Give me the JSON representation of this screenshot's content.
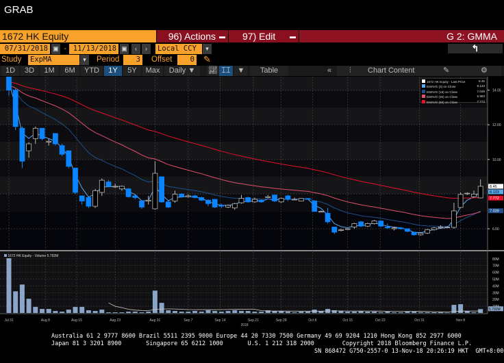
{
  "window": {
    "title": "GRAB"
  },
  "header": {
    "security": "1672 HK Equity",
    "actions": "96) Actions",
    "edit": "97) Edit",
    "page_code": "G 2: GMMA"
  },
  "dates": {
    "start": "07/31/2018",
    "sep": "-",
    "end": "11/13/2018",
    "currency": "Local CCY"
  },
  "study": {
    "label": "Study",
    "value": "ExpMA",
    "period_label": "Period",
    "period": "3",
    "offset_label": "Offset",
    "offset": "0"
  },
  "tabs": {
    "ranges": [
      "1D",
      "3D",
      "1M",
      "6M",
      "YTD",
      "1Y",
      "5Y",
      "Max"
    ],
    "active": "1Y",
    "frequency": "Daily",
    "table": "Table",
    "chart_content": "Chart Content"
  },
  "legend": {
    "items": [
      {
        "label": "1672 HK Equity - Last Price",
        "value": "8.45",
        "color": "#ffffff"
      },
      {
        "label": "EMAVG (3) on Close",
        "value": "8.133",
        "color": "#5aaaf0"
      },
      {
        "label": "EMAVG (15) on Close",
        "value": "7.039",
        "color": "#1e4f8a"
      },
      {
        "label": "EMAVG (30) on Close",
        "value": "6.983",
        "color": "#e0506a"
      },
      {
        "label": "EMAVG (60) on Close",
        "value": "7.772",
        "color": "#e8102a"
      }
    ]
  },
  "volume_legend": "1672 HK Equity - Volume 5.792M",
  "chart_data": {
    "type": "candlestick",
    "price_ticks": [
      "14.00",
      "12.00",
      "10.00",
      "6.00"
    ],
    "price_tick_values": [
      14,
      12,
      10,
      6
    ],
    "price_tags": [
      {
        "text": "8.45",
        "value": 8.45,
        "bg": "#ffffff",
        "fg": "#000"
      },
      {
        "text": "8.133",
        "value": 8.133,
        "bg": "#5aaaf0",
        "fg": "#000"
      },
      {
        "text": "7.772",
        "value": 7.772,
        "bg": "#e8102a",
        "fg": "#fff"
      },
      {
        "text": "7.039",
        "value": 7.039,
        "bg": "#1e4f8a",
        "fg": "#fff"
      }
    ],
    "volume_ticks": [
      "80M",
      "70M",
      "60M",
      "50M",
      "40M",
      "30M",
      "20M",
      "10M"
    ],
    "volume_tag": "5.792M",
    "x_labels": [
      {
        "text": "Jul 31",
        "i": 0
      },
      {
        "text": "Aug 8",
        "i": 5.5
      },
      {
        "text": "Aug 15",
        "i": 10.2
      },
      {
        "text": "Aug 23",
        "i": 16
      },
      {
        "text": "Aug 31",
        "i": 22
      },
      {
        "text": "Sep 7",
        "i": 27
      },
      {
        "text": "Sep 14",
        "i": 31.8
      },
      {
        "text": "Sep 21",
        "i": 36.8
      },
      {
        "text": "Sep 28",
        "i": 41
      },
      {
        "text": "Oct 8",
        "i": 45.7
      },
      {
        "text": "Oct 15",
        "i": 51
      },
      {
        "text": "Oct 23",
        "i": 55.9
      },
      {
        "text": "Oct 31",
        "i": 61.8
      },
      {
        "text": "Nov 8",
        "i": 68
      }
    ],
    "year_label": "2018",
    "ohlc": [
      [
        14.8,
        14.9,
        13.7,
        14.0
      ],
      [
        14.0,
        14.1,
        11.7,
        11.9
      ],
      [
        11.8,
        11.9,
        9.5,
        9.9
      ],
      [
        10.5,
        11.0,
        10.1,
        10.9
      ],
      [
        11.2,
        11.9,
        10.9,
        11.8
      ],
      [
        11.8,
        11.8,
        11.1,
        11.2
      ],
      [
        11.0,
        11.2,
        10.8,
        11.05
      ],
      [
        11.5,
        11.5,
        10.8,
        10.9
      ],
      [
        10.8,
        10.9,
        10.2,
        10.3
      ],
      [
        10.5,
        10.5,
        9.5,
        9.6
      ],
      [
        9.5,
        9.5,
        8.0,
        8.1
      ],
      [
        7.9,
        7.9,
        7.4,
        7.6
      ],
      [
        7.8,
        7.8,
        7.2,
        7.3
      ],
      [
        7.3,
        8.3,
        7.2,
        8.2
      ],
      [
        8.1,
        8.9,
        7.9,
        8.8
      ],
      [
        8.7,
        8.8,
        8.4,
        8.45
      ],
      [
        8.45,
        8.6,
        8.35,
        8.45
      ],
      [
        8.3,
        8.5,
        8.2,
        8.45
      ],
      [
        8.3,
        8.35,
        7.8,
        7.85
      ],
      [
        7.9,
        7.95,
        7.7,
        7.8
      ],
      [
        7.6,
        7.6,
        7.15,
        7.25
      ],
      [
        7.6,
        7.9,
        7.4,
        7.65
      ],
      [
        7.15,
        9.9,
        7.1,
        9.2
      ],
      [
        9.0,
        9.0,
        7.5,
        7.55
      ],
      [
        7.55,
        7.6,
        7.2,
        7.25
      ],
      [
        7.6,
        8.2,
        7.5,
        8.0
      ],
      [
        8.0,
        8.05,
        7.8,
        7.85
      ],
      [
        7.85,
        8.0,
        7.8,
        7.9
      ],
      [
        7.9,
        7.95,
        7.75,
        7.8
      ],
      [
        7.8,
        7.85,
        7.6,
        7.65
      ],
      [
        7.65,
        7.7,
        7.3,
        7.45
      ],
      [
        7.7,
        7.7,
        7.2,
        7.25
      ],
      [
        7.35,
        7.45,
        7.2,
        7.3
      ],
      [
        7.25,
        7.4,
        7.2,
        7.35
      ],
      [
        7.2,
        7.5,
        7.1,
        7.45
      ],
      [
        7.5,
        7.95,
        7.45,
        7.75
      ],
      [
        7.8,
        7.85,
        7.5,
        7.55
      ],
      [
        7.55,
        7.8,
        7.5,
        7.7
      ],
      [
        7.65,
        7.7,
        7.5,
        7.55
      ],
      [
        7.8,
        7.95,
        7.75,
        7.85
      ],
      [
        7.95,
        7.95,
        7.55,
        7.6
      ],
      [
        7.55,
        7.8,
        7.5,
        7.75
      ],
      [
        7.9,
        7.95,
        7.6,
        7.7
      ],
      [
        7.7,
        7.8,
        7.65,
        7.7
      ],
      [
        7.6,
        7.75,
        7.6,
        7.75
      ],
      [
        7.75,
        7.75,
        7.7,
        7.7
      ],
      [
        7.6,
        7.6,
        7.0,
        7.0
      ],
      [
        7.0,
        7.05,
        6.95,
        7.0
      ],
      [
        6.9,
        7.2,
        6.3,
        6.4
      ],
      [
        6.1,
        6.1,
        5.7,
        5.8
      ],
      [
        5.9,
        6.0,
        5.85,
        5.95
      ],
      [
        6.0,
        6.0,
        5.95,
        6.0
      ],
      [
        6.1,
        6.35,
        6.0,
        6.3
      ],
      [
        6.4,
        6.45,
        6.1,
        6.15
      ],
      [
        6.15,
        6.35,
        6.1,
        6.3
      ],
      [
        6.3,
        6.5,
        6.25,
        6.45
      ],
      [
        6.45,
        6.45,
        6.1,
        6.15
      ],
      [
        6.1,
        6.3,
        6.0,
        6.05
      ],
      [
        6.0,
        6.1,
        5.9,
        6.05
      ],
      [
        6.05,
        6.1,
        5.95,
        6.0
      ],
      [
        6.0,
        6.0,
        5.8,
        5.85
      ],
      [
        5.8,
        5.8,
        5.6,
        5.65
      ],
      [
        5.65,
        5.8,
        5.6,
        5.75
      ],
      [
        5.75,
        6.0,
        5.7,
        5.95
      ],
      [
        5.95,
        6.1,
        5.9,
        6.05
      ],
      [
        6.05,
        6.2,
        6.0,
        6.1
      ],
      [
        6.1,
        6.15,
        6.05,
        6.1
      ],
      [
        6.08,
        7.5,
        6.0,
        7.03
      ],
      [
        7.23,
        8.1,
        7.2,
        7.98
      ],
      [
        8.05,
        8.1,
        7.95,
        8.05
      ],
      [
        7.85,
        8.2,
        7.8,
        8.0
      ],
      [
        7.78,
        8.85,
        7.75,
        8.45
      ]
    ],
    "volume": [
      82,
      32,
      42,
      21,
      9,
      6,
      6,
      3,
      2,
      5,
      9,
      9,
      4,
      3,
      5,
      1,
      1,
      1,
      2,
      2,
      1,
      2,
      33,
      15,
      4,
      3,
      2,
      2,
      3,
      2,
      4,
      3,
      2,
      3,
      4,
      3,
      3,
      2,
      2,
      4,
      3,
      3,
      2,
      1,
      2,
      2,
      5,
      3,
      6,
      4,
      3,
      2,
      2,
      3,
      2,
      2,
      1,
      2,
      1,
      1,
      2,
      2,
      1,
      1,
      1,
      1,
      0.5,
      12,
      13,
      3,
      1,
      5.8
    ],
    "ema_periods": [
      3,
      15,
      30,
      60
    ],
    "ema_seed": [
      14.8,
      14.2,
      14.3,
      14.5
    ]
  },
  "footer": {
    "line1": "Australia 61 2 9777 8600 Brazil 5511 2395 9000 Europe 44 20 7330 7500 Germany 49 69 9204 1210 Hong Kong 852 2977 6000",
    "line2": "Japan 81 3 3201 8900       Singapore 65 6212 1000       U.S. 1 212 318 2000        Copyright 2018 Bloomberg Finance L.P.",
    "line3": "SN 868472 G750-2557-0 13-Nov-18 20:26:19 HKT  GMT+8:00"
  }
}
